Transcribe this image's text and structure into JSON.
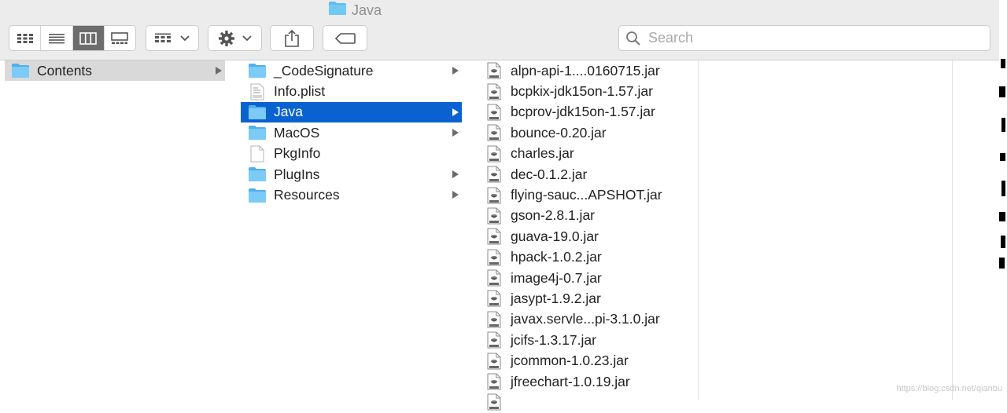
{
  "window": {
    "title": "Java",
    "title_icon": "folder-icon"
  },
  "toolbar": {
    "view_modes": [
      {
        "name": "icon-view",
        "icon": "grid-icon",
        "active": false
      },
      {
        "name": "list-view",
        "icon": "list-icon",
        "active": false
      },
      {
        "name": "column-view",
        "icon": "columns-icon",
        "active": true
      },
      {
        "name": "gallery-view",
        "icon": "gallery-icon",
        "active": false
      }
    ],
    "group_button_icon": "group-icon",
    "action_button_icon": "gear-icon",
    "share_button_icon": "share-icon",
    "tag_button_icon": "tag-icon"
  },
  "search": {
    "placeholder": "Search",
    "value": ""
  },
  "columns": {
    "col1": [
      {
        "label": "Contents",
        "type": "folder",
        "has_children": true,
        "state": "selected-inactive"
      }
    ],
    "col2": [
      {
        "label": "_CodeSignature",
        "type": "folder",
        "has_children": true
      },
      {
        "label": "Info.plist",
        "type": "plist",
        "has_children": false
      },
      {
        "label": "Java",
        "type": "folder",
        "has_children": true,
        "state": "selected"
      },
      {
        "label": "MacOS",
        "type": "folder",
        "has_children": true
      },
      {
        "label": "PkgInfo",
        "type": "file",
        "has_children": false
      },
      {
        "label": "PlugIns",
        "type": "folder",
        "has_children": true
      },
      {
        "label": "Resources",
        "type": "folder",
        "has_children": true
      }
    ],
    "col3": [
      {
        "label": "alpn-api-1....0160715.jar",
        "type": "jar"
      },
      {
        "label": "bcpkix-jdk15on-1.57.jar",
        "type": "jar"
      },
      {
        "label": "bcprov-jdk15on-1.57.jar",
        "type": "jar"
      },
      {
        "label": "bounce-0.20.jar",
        "type": "jar"
      },
      {
        "label": "charles.jar",
        "type": "jar"
      },
      {
        "label": "dec-0.1.2.jar",
        "type": "jar"
      },
      {
        "label": "flying-sauc...APSHOT.jar",
        "type": "jar"
      },
      {
        "label": "gson-2.8.1.jar",
        "type": "jar"
      },
      {
        "label": "guava-19.0.jar",
        "type": "jar"
      },
      {
        "label": "hpack-1.0.2.jar",
        "type": "jar"
      },
      {
        "label": "image4j-0.7.jar",
        "type": "jar"
      },
      {
        "label": "jasypt-1.9.2.jar",
        "type": "jar"
      },
      {
        "label": "javax.servle...pi-3.1.0.jar",
        "type": "jar"
      },
      {
        "label": "jcifs-1.3.17.jar",
        "type": "jar"
      },
      {
        "label": "jcommon-1.0.23.jar",
        "type": "jar"
      },
      {
        "label": "jfreechart-1.0.19.jar",
        "type": "jar"
      },
      {
        "label": "",
        "type": "jar"
      }
    ]
  },
  "colors": {
    "selection_active": "#0a62d0",
    "selection_inactive": "#d9d9d9",
    "folder": "#5fbcf2"
  },
  "watermark": "https://blog.csdn.net/qianbu"
}
